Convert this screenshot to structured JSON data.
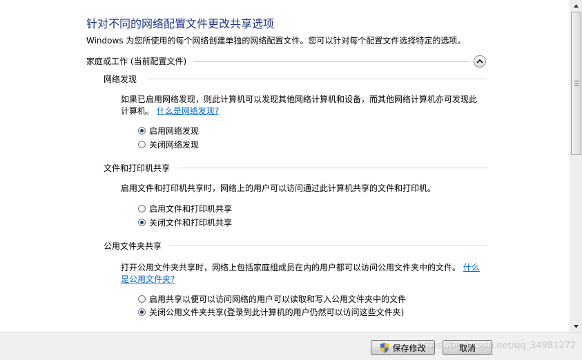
{
  "title": "针对不同的网络配置文件更改共享选项",
  "subtitle": "Windows 为您所使用的每个网络创建单独的网络配置文件。您可以针对每个配置文件选择特定的选项。",
  "profile": {
    "label": "家庭或工作 (当前配置文件)"
  },
  "sections": {
    "network_discovery": {
      "title": "网络发现",
      "desc_line1": "如果已启用网络发现，则此计算机可以发现其他网络计算机和设备，而其他网络计算机亦可发现此",
      "desc_line2": "计算机。",
      "link": "什么是网络发现?",
      "options": [
        {
          "label": "启用网络发现",
          "checked": true
        },
        {
          "label": "关闭网络发现",
          "checked": false
        }
      ]
    },
    "file_printer_sharing": {
      "title": "文件和打印机共享",
      "desc": "启用文件和打印机共享时，网络上的用户可以访问通过此计算机共享的文件和打印机。",
      "options": [
        {
          "label": "启用文件和打印机共享",
          "checked": false
        },
        {
          "label": "关闭文件和打印机共享",
          "checked": true
        }
      ]
    },
    "public_folder_sharing": {
      "title": "公用文件夹共享",
      "desc": "打开公用文件夹共享时，网络上包括家庭组成员在内的用户都可以访问公用文件夹中的文件。",
      "link_part1": "什么",
      "link_part2": "是公用文件夹?",
      "options": [
        {
          "label": "启用共享以便可以访问网络的用户可以读取和写入公用文件夹中的文件",
          "checked": false
        },
        {
          "label": "关闭公用文件夹共享(登录到此计算机的用户仍然可以访问这些文件夹)",
          "checked": true
        }
      ]
    }
  },
  "footer": {
    "save_label": "保存修改",
    "cancel_label": "取消"
  },
  "watermark": "https://blog.csdn.net/qq_34981272",
  "colors": {
    "title": "#1e3287",
    "link": "#0066cc",
    "footer_bg": "#f0f0f0"
  }
}
